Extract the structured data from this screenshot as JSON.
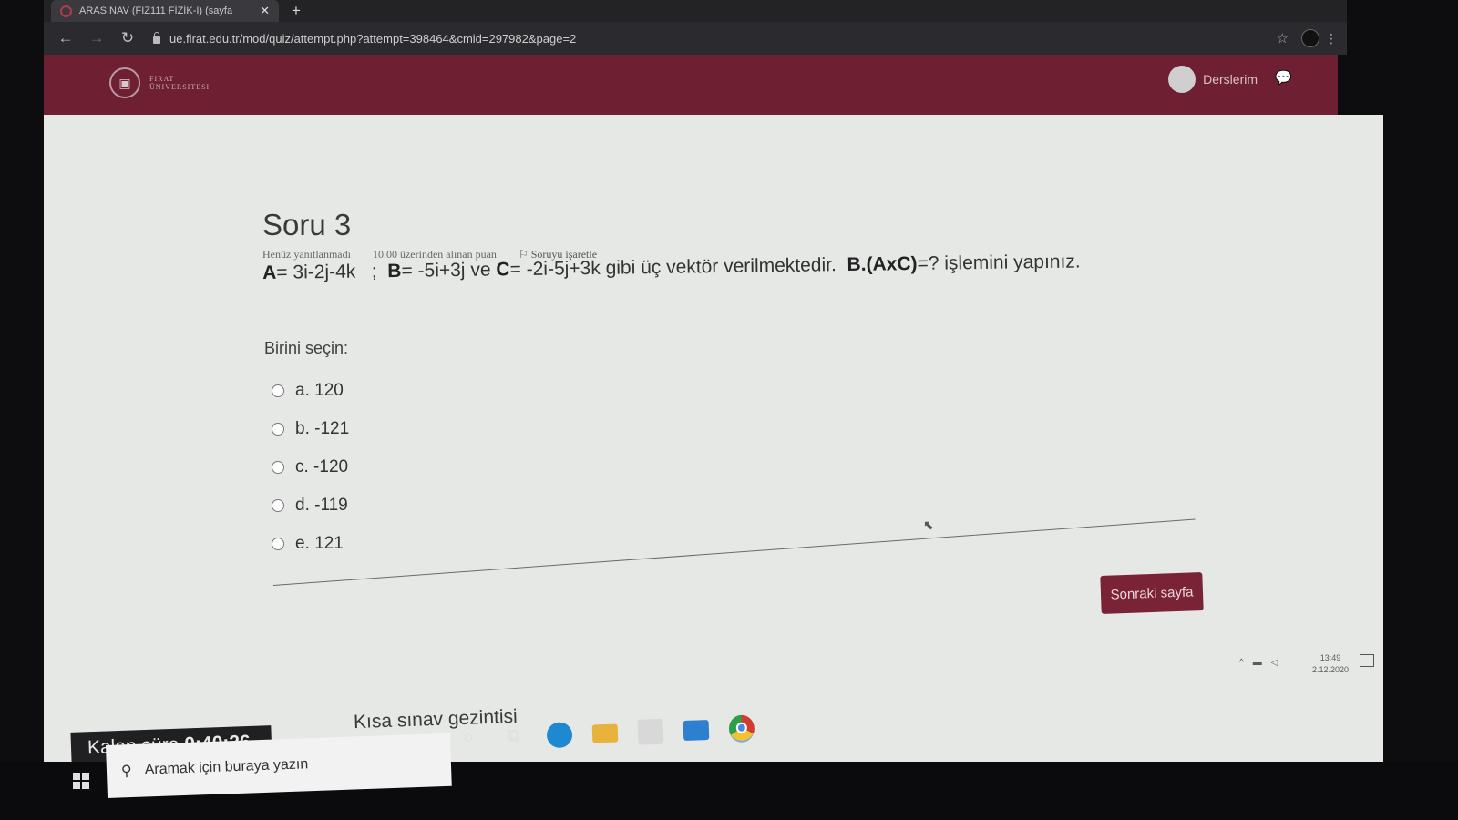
{
  "browser": {
    "tab_title": "ARASINAV (FIZ111 FİZİK-I) (sayfa",
    "tab_close": "✕",
    "new_tab": "+",
    "url": "ue.firat.edu.tr/mod/quiz/attempt.php?attempt=398464&cmid=297982&page=2"
  },
  "header": {
    "logo_line1": "FIRAT",
    "logo_line2": "ÜNIVERSITESI",
    "courses_label": "Derslerim"
  },
  "question": {
    "title": "Soru 3",
    "status": "Henüz yanıtlanmadı",
    "marks": "10.00 üzerinden alınan puan",
    "flag_label": "Soruyu işaretle",
    "text_A_label": "A",
    "text_A_expr": "= 3i-2j-4k",
    "text_sep": ";",
    "text_B_label": "B",
    "text_B_expr": "= -5i+3j",
    "text_ve": "ve",
    "text_C_label": "C",
    "text_C_expr": "= -2i-5j+3k",
    "text_mid": "gibi üç vektör verilmektedir.",
    "text_op": "B.(AxC)",
    "text_end": "=? işlemini yapınız.",
    "prompt": "Birini seçin:",
    "answers": [
      {
        "label": "a. 120"
      },
      {
        "label": "b. -121"
      },
      {
        "label": "c. -120"
      },
      {
        "label": "d. -119"
      },
      {
        "label": "e. 121"
      }
    ],
    "next_button": "Sonraki sayfa"
  },
  "footer": {
    "timer_label": "Kalan süre",
    "timer_value": "0:40:26",
    "quiz_nav": "Kısa sınav gezintisi"
  },
  "taskbar": {
    "search_placeholder": "Aramak için buraya yazın",
    "clock_time": "13:49",
    "clock_date": "2.12.2020"
  },
  "colors": {
    "brand": "#6e1f32",
    "button": "#7a2336",
    "page_bg": "#e6e8e6"
  }
}
